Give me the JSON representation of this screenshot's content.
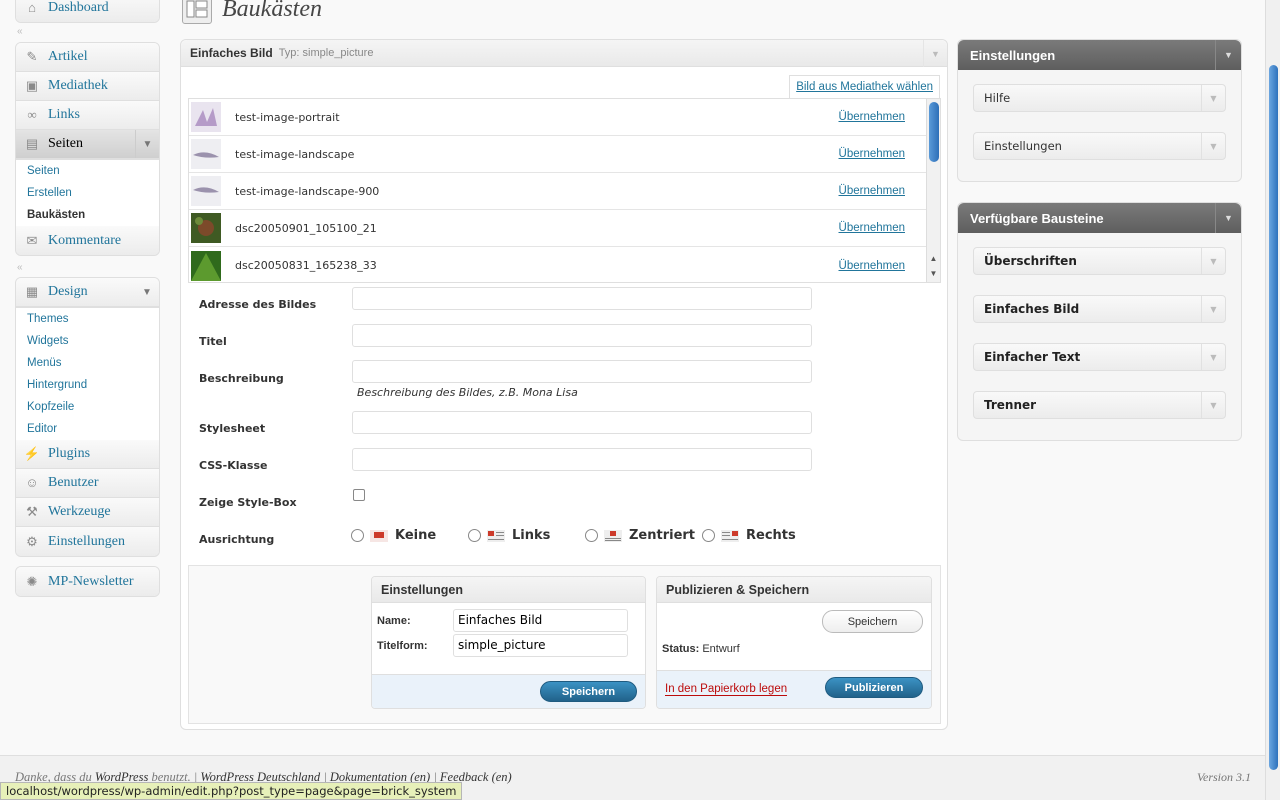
{
  "sidebar": {
    "dashboard": "Dashboard",
    "group2": [
      "Artikel",
      "Mediathek",
      "Links"
    ],
    "seiten": "Seiten",
    "seiten_sub": [
      "Seiten",
      "Erstellen",
      "Baukästen"
    ],
    "kommentare": "Kommentare",
    "design": "Design",
    "design_sub": [
      "Themes",
      "Widgets",
      "Menüs",
      "Hintergrund",
      "Kopfzeile",
      "Editor"
    ],
    "group4": [
      "Plugins",
      "Benutzer",
      "Werkzeuge",
      "Einstellungen"
    ],
    "newsletter": "MP-Newsletter"
  },
  "page": {
    "title": "Baukästen"
  },
  "box": {
    "title": "Einfaches Bild",
    "type_label": "Typ: simple_picture",
    "media_tab": "Bild aus Mediathek wählen"
  },
  "media_list": [
    {
      "name": "test-image-portrait",
      "action": "Übernehmen"
    },
    {
      "name": "test-image-landscape",
      "action": "Übernehmen"
    },
    {
      "name": "test-image-landscape-900",
      "action": "Übernehmen"
    },
    {
      "name": "dsc20050901_105100_21",
      "action": "Übernehmen"
    },
    {
      "name": "dsc20050831_165238_33",
      "action": "Übernehmen"
    }
  ],
  "form": {
    "address": "Adresse des Bildes",
    "title": "Titel",
    "description": "Beschreibung",
    "description_hint": "Beschreibung des Bildes, z.B. Mona Lisa",
    "stylesheet": "Stylesheet",
    "css_class": "CSS-Klasse",
    "stylebox": "Zeige Style-Box",
    "alignment": "Ausrichtung",
    "align_options": [
      "Keine",
      "Links",
      "Zentriert",
      "Rechts"
    ]
  },
  "settings_box": {
    "title": "Einstellungen",
    "name_label": "Name:",
    "name_value": "Einfaches Bild",
    "titleform_label": "Titelform:",
    "titleform_value": "simple_picture",
    "save": "Speichern"
  },
  "publish_box": {
    "title": "Publizieren & Speichern",
    "save": "Speichern",
    "status_label": "Status:",
    "status_value": "Entwurf",
    "trash": "In den Papierkorb legen",
    "publish": "Publizieren"
  },
  "widgets": {
    "settings_title": "Einstellungen",
    "settings_items": [
      "Hilfe",
      "Einstellungen"
    ],
    "blocks_title": "Verfügbare Bausteine",
    "blocks": [
      "Überschriften",
      "Einfaches Bild",
      "Einfacher Text",
      "Trenner"
    ]
  },
  "footer": {
    "thanks_pre": "Danke, dass du",
    "wordpress": "WordPress",
    "thanks_post": "benutzt.",
    "sep": "|",
    "wp_de": "WordPress Deutschland",
    "docs": "Dokumentation",
    "en": "(en)",
    "feedback": "Feedback",
    "version": "Version 3.1"
  },
  "status_bar": "localhost/wordpress/wp-admin/edit.php?post_type=page&page=brick_system",
  "colors": {
    "link": "#21759b",
    "primary_button": "#2a7ab0",
    "widget_header": "#6d6d6d",
    "trash": "#bc0b0b"
  }
}
